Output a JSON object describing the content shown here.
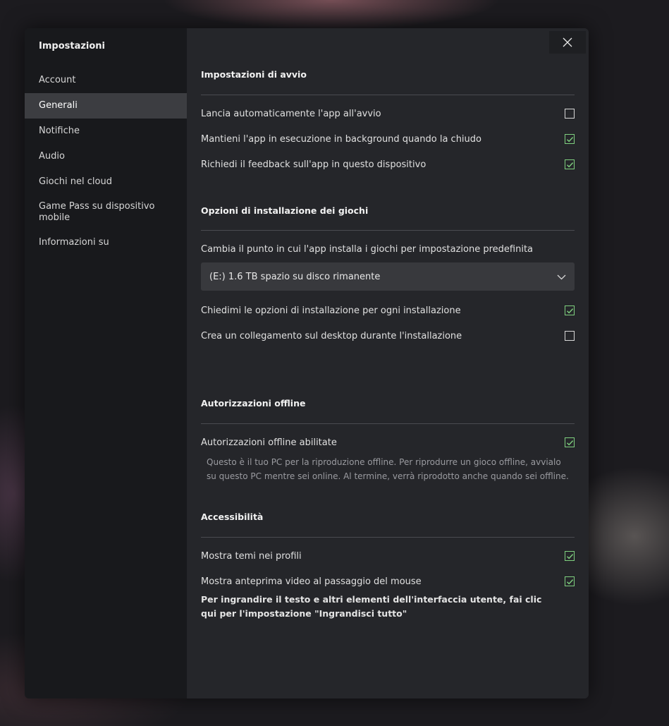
{
  "sidebar": {
    "title": "Impostazioni",
    "items": [
      {
        "label": "Account"
      },
      {
        "label": "Generali"
      },
      {
        "label": "Notifiche"
      },
      {
        "label": "Audio"
      },
      {
        "label": "Giochi nel cloud"
      },
      {
        "label": "Game Pass su dispositivo mobile"
      },
      {
        "label": "Informazioni su"
      }
    ],
    "active_index": 1
  },
  "close_icon": "close-icon",
  "sections": {
    "startup": {
      "title": "Impostazioni di avvio",
      "options": [
        {
          "label": "Lancia automaticamente l'app all'avvio",
          "checked": false
        },
        {
          "label": "Mantieni l'app in esecuzione in background quando la chiudo",
          "checked": true
        },
        {
          "label": "Richiedi il feedback sull'app in questo dispositivo",
          "checked": true
        }
      ]
    },
    "install": {
      "title": "Opzioni di installazione dei giochi",
      "location_label": "Cambia il punto in cui l'app installa i giochi per impostazione predefinita",
      "dropdown_value": "(E:) 1.6 TB spazio su disco rimanente",
      "options": [
        {
          "label": "Chiedimi le opzioni di installazione per ogni installazione",
          "checked": true
        },
        {
          "label": "Crea un collegamento sul desktop durante l'installazione",
          "checked": false
        }
      ]
    },
    "offline": {
      "title": "Autorizzazioni offline",
      "option": {
        "label": "Autorizzazioni offline abilitate",
        "checked": true
      },
      "description": "Questo è il tuo PC per la riproduzione offline. Per riprodurre un gioco offline, avvialo su questo PC mentre sei online. Al termine, verrà riprodotto anche quando sei offline."
    },
    "accessibility": {
      "title": "Accessibilità",
      "options": [
        {
          "label": "Mostra temi nei profili",
          "checked": true
        },
        {
          "label": "Mostra anteprima video al passaggio del mouse",
          "checked": true
        }
      ],
      "link_text": "Per ingrandire il testo e altri elementi dell'interfaccia utente, fai clic qui per l'impostazione \"Ingrandisci tutto\""
    }
  },
  "colors": {
    "check_green": "#7fd07f",
    "sidebar_bg": "#18191c",
    "main_bg": "#25262a",
    "active_item_bg": "#3c3d41"
  }
}
